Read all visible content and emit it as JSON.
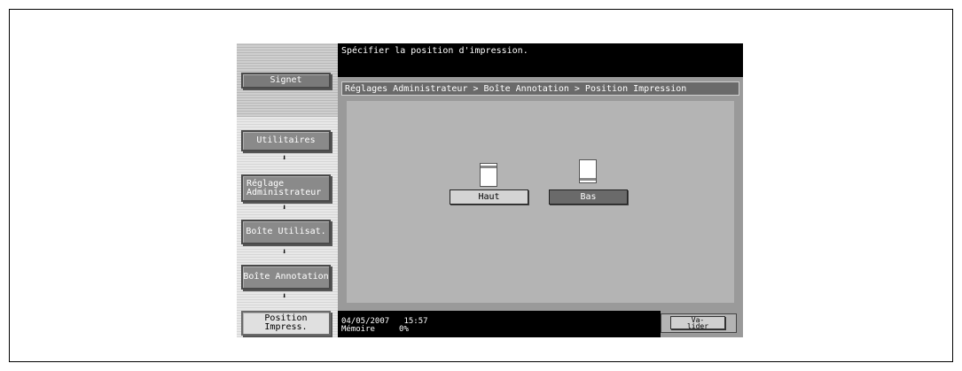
{
  "header": {
    "message": "Spécifier la position d'impression."
  },
  "sidebar": {
    "signet_label": "Signet",
    "path": [
      {
        "label": "Utilitaires"
      },
      {
        "label": "Réglage\nAdministrateur"
      },
      {
        "label": "Boîte Utilisat."
      },
      {
        "label": "Boîte Annotation"
      },
      {
        "label": "Position\nImpress."
      }
    ],
    "arrow_glyph": "⬇"
  },
  "breadcrumb": "Réglages Administrateur > Boîte Annotation > Position Impression",
  "options": {
    "haut_label": "Haut",
    "bas_label": "Bas",
    "selected": "Bas"
  },
  "status": {
    "date": "04/05/2007",
    "time": "15:57",
    "memory_label": "Mémoire",
    "memory_value": "0%"
  },
  "footer": {
    "validate_label": "Va-\nlider"
  },
  "colors": {
    "screen_bg": "#000000",
    "panel_bg": "#b4b4b4",
    "selected_button": "#6a6a6a"
  }
}
